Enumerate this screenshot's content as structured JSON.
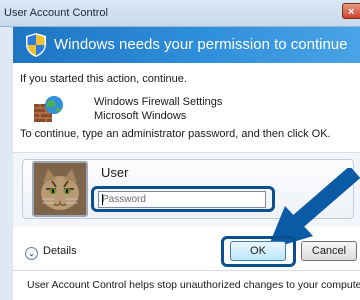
{
  "window": {
    "title": "User Account Control",
    "close_label": "×"
  },
  "header": {
    "heading": "Windows needs your permission to continue",
    "icon": "uac-shield-icon"
  },
  "body": {
    "intro": "If you started this action, continue.",
    "program_name": "Windows Firewall Settings",
    "publisher": "Microsoft Windows",
    "instruction": "To continue, type an administrator password, and then click OK."
  },
  "credential": {
    "user_name": "User",
    "password_placeholder": "Password",
    "password_value": ""
  },
  "actions": {
    "details_label": "Details",
    "ok_label": "OK",
    "cancel_label": "Cancel"
  },
  "footer": {
    "text": "User Account Control helps stop unauthorized changes to your computer."
  },
  "colors": {
    "accent_blue": "#0b4f8c",
    "header_blue": "#1d75c4"
  }
}
